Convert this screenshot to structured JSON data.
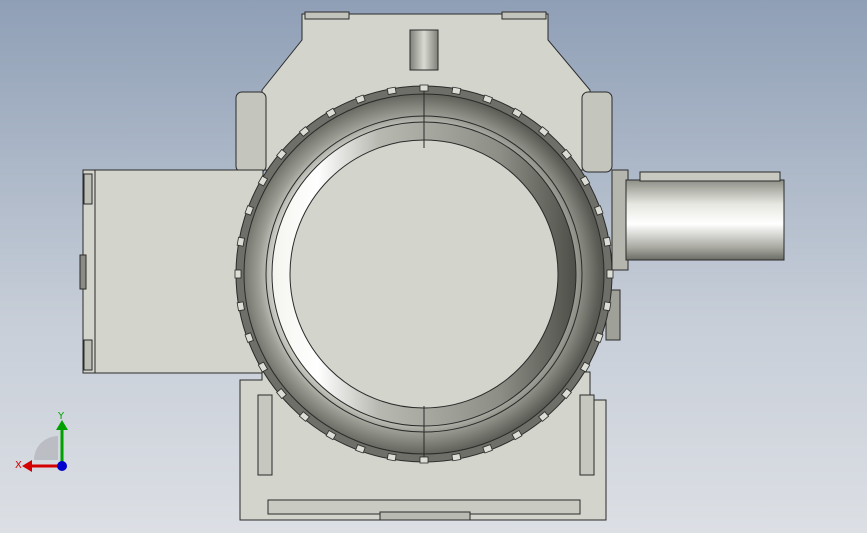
{
  "viewport": {
    "background_top": "#8f9fb6",
    "background_bottom": "#dcdfe4",
    "model_color": "#d3d4cb",
    "model_edge_color": "#2a2a2a"
  },
  "triad": {
    "x_label": "X",
    "y_label": "Y",
    "x_color": "#d40000",
    "y_color": "#00a000",
    "z_color": "#0000cc"
  }
}
